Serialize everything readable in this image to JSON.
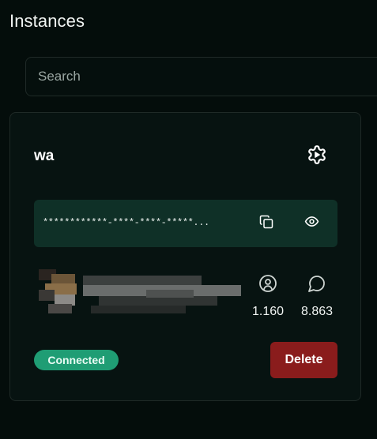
{
  "page": {
    "title": "Instances"
  },
  "search": {
    "placeholder": "Search"
  },
  "instance": {
    "name": "wa",
    "token_masked": "************-****-****-*****...",
    "stats": {
      "contacts": "1.160",
      "chats": "8.863"
    },
    "status": "Connected",
    "delete_label": "Delete"
  },
  "colors": {
    "background": "#040d0b",
    "card": "#071311",
    "token_box": "#0f3027",
    "status_connected": "#1f9d74",
    "delete": "#8a1c1c"
  },
  "icons": {
    "settings": "gear-icon",
    "copy": "copy-icon",
    "reveal": "eye-icon",
    "contacts": "user-circle-icon",
    "chats": "message-circle-icon"
  }
}
